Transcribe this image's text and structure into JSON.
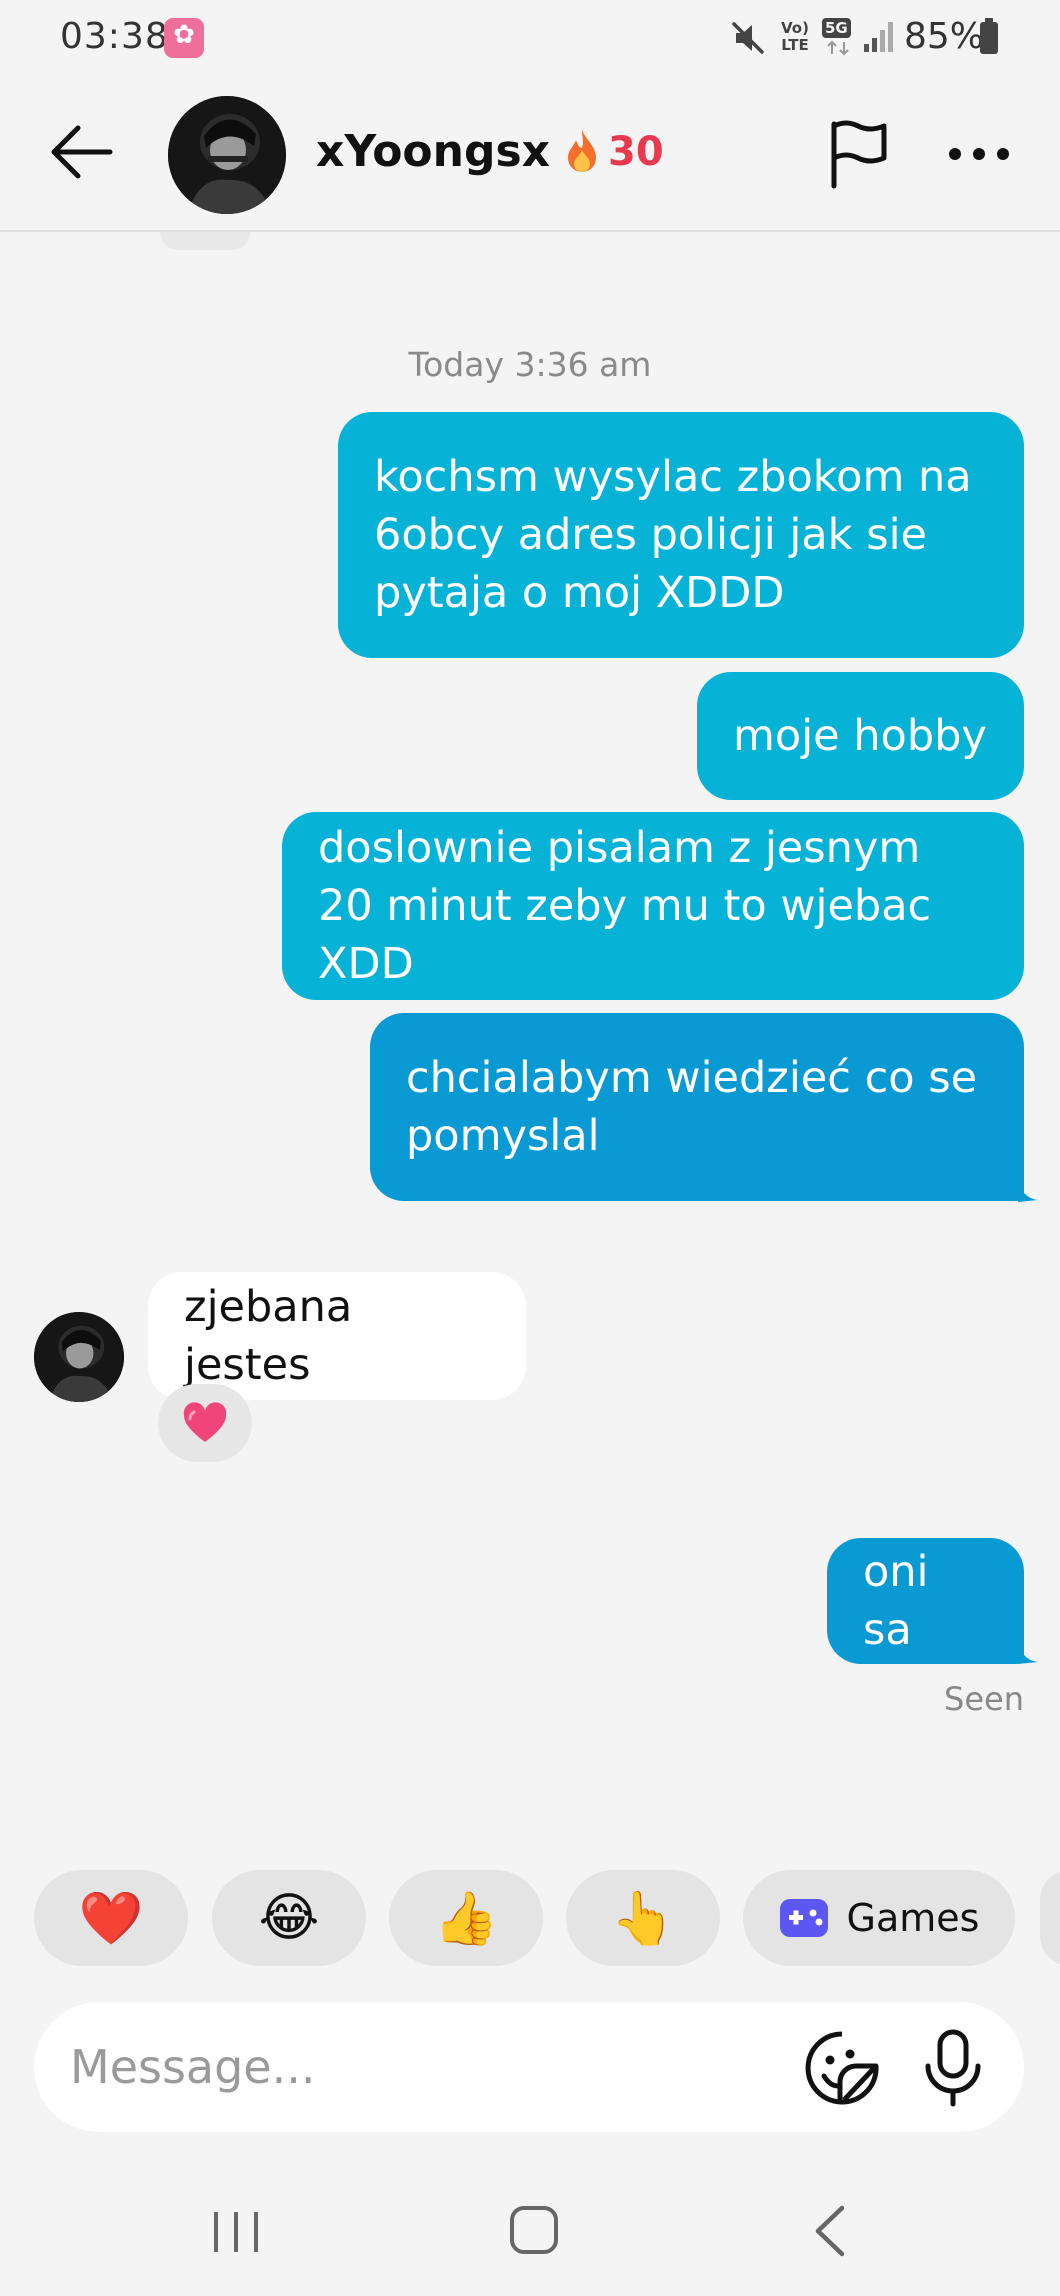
{
  "status_bar": {
    "time": "03:38",
    "volte": "Vo)\nLTE",
    "network": "5G",
    "battery": "85%"
  },
  "header": {
    "username": "xYoongsx",
    "streak_count": "30"
  },
  "chat": {
    "timestamp": "Today 3:36 am",
    "messages": [
      {
        "dir": "out",
        "text": "kochsm wysylac zbokom na 6obcy adres policji jak sie pytaja o moj XDDD"
      },
      {
        "dir": "out",
        "text": "moje hobby"
      },
      {
        "dir": "out",
        "text": "doslownie pisalam z jesnym 20 minut zeby mu to wjebac XDD"
      },
      {
        "dir": "out",
        "text": "chcialabym wiedzieć co se pomyslal"
      },
      {
        "dir": "in",
        "text": "zjebana jestes",
        "reaction": "💗"
      },
      {
        "dir": "out",
        "text": "oni sa"
      }
    ],
    "seen": "Seen"
  },
  "quick_replies": {
    "chips": [
      "❤️",
      "😂",
      "👍",
      "👆"
    ],
    "games_label": "Games"
  },
  "composer": {
    "placeholder": "Message..."
  },
  "colors": {
    "outgoing_bubble": "#06b3d6",
    "outgoing_bubble_last": "#0a9ad3",
    "incoming_bubble": "#ffffff",
    "streak": "#e8394f",
    "background": "#f4f4f4"
  }
}
